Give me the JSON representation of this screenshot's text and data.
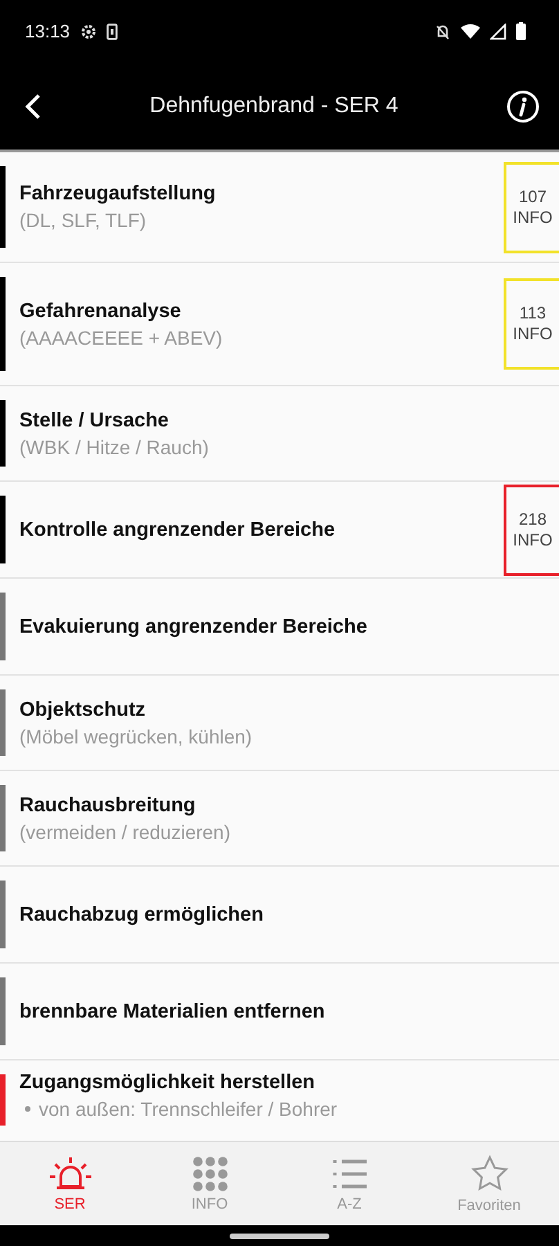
{
  "status_bar": {
    "time": "13:13"
  },
  "header": {
    "title": "Dehnfugenbrand - SER 4"
  },
  "items": [
    {
      "title": "Fahrzeugaufstellung",
      "subtitle": "(DL, SLF, TLF)",
      "color": "#000000",
      "info": {
        "number": "107",
        "label": "INFO",
        "color": "#f2e22a"
      }
    },
    {
      "title": "Gefahrenanalyse",
      "subtitle": "(AAAACEEEE + ABEV)",
      "color": "#000000",
      "info": {
        "number": "113",
        "label": "INFO",
        "color": "#f2e22a"
      }
    },
    {
      "title": "Stelle / Ursache",
      "subtitle": "(WBK / Hitze / Rauch)",
      "color": "#000000"
    },
    {
      "title": "Kontrolle angrenzender Bereiche",
      "color": "#000000",
      "info": {
        "number": "218",
        "label": "INFO",
        "color": "#e8202a"
      }
    },
    {
      "title": "Evakuierung angrenzender Bereiche",
      "color": "#777777"
    },
    {
      "title": "Objektschutz",
      "subtitle": "(Möbel wegrücken, kühlen)",
      "color": "#777777"
    },
    {
      "title": "Rauchausbreitung",
      "subtitle": "(vermeiden / reduzieren)",
      "color": "#777777"
    },
    {
      "title": "Rauchabzug ermöglichen",
      "color": "#777777"
    },
    {
      "title": "brennbare Materialien entfernen",
      "color": "#777777"
    },
    {
      "title": "Zugangsmöglichkeit herstellen",
      "bullets": [
        "von außen: Trennschleifer / Bohrer"
      ],
      "color": "#e8202a"
    }
  ],
  "tabs": [
    {
      "kind": "siren",
      "label": "SER",
      "selected": true
    },
    {
      "kind": "grid",
      "label": "INFO",
      "selected": false
    },
    {
      "kind": "list",
      "label": "A-Z",
      "selected": false
    },
    {
      "kind": "star",
      "label": "Favoriten",
      "selected": false
    }
  ]
}
